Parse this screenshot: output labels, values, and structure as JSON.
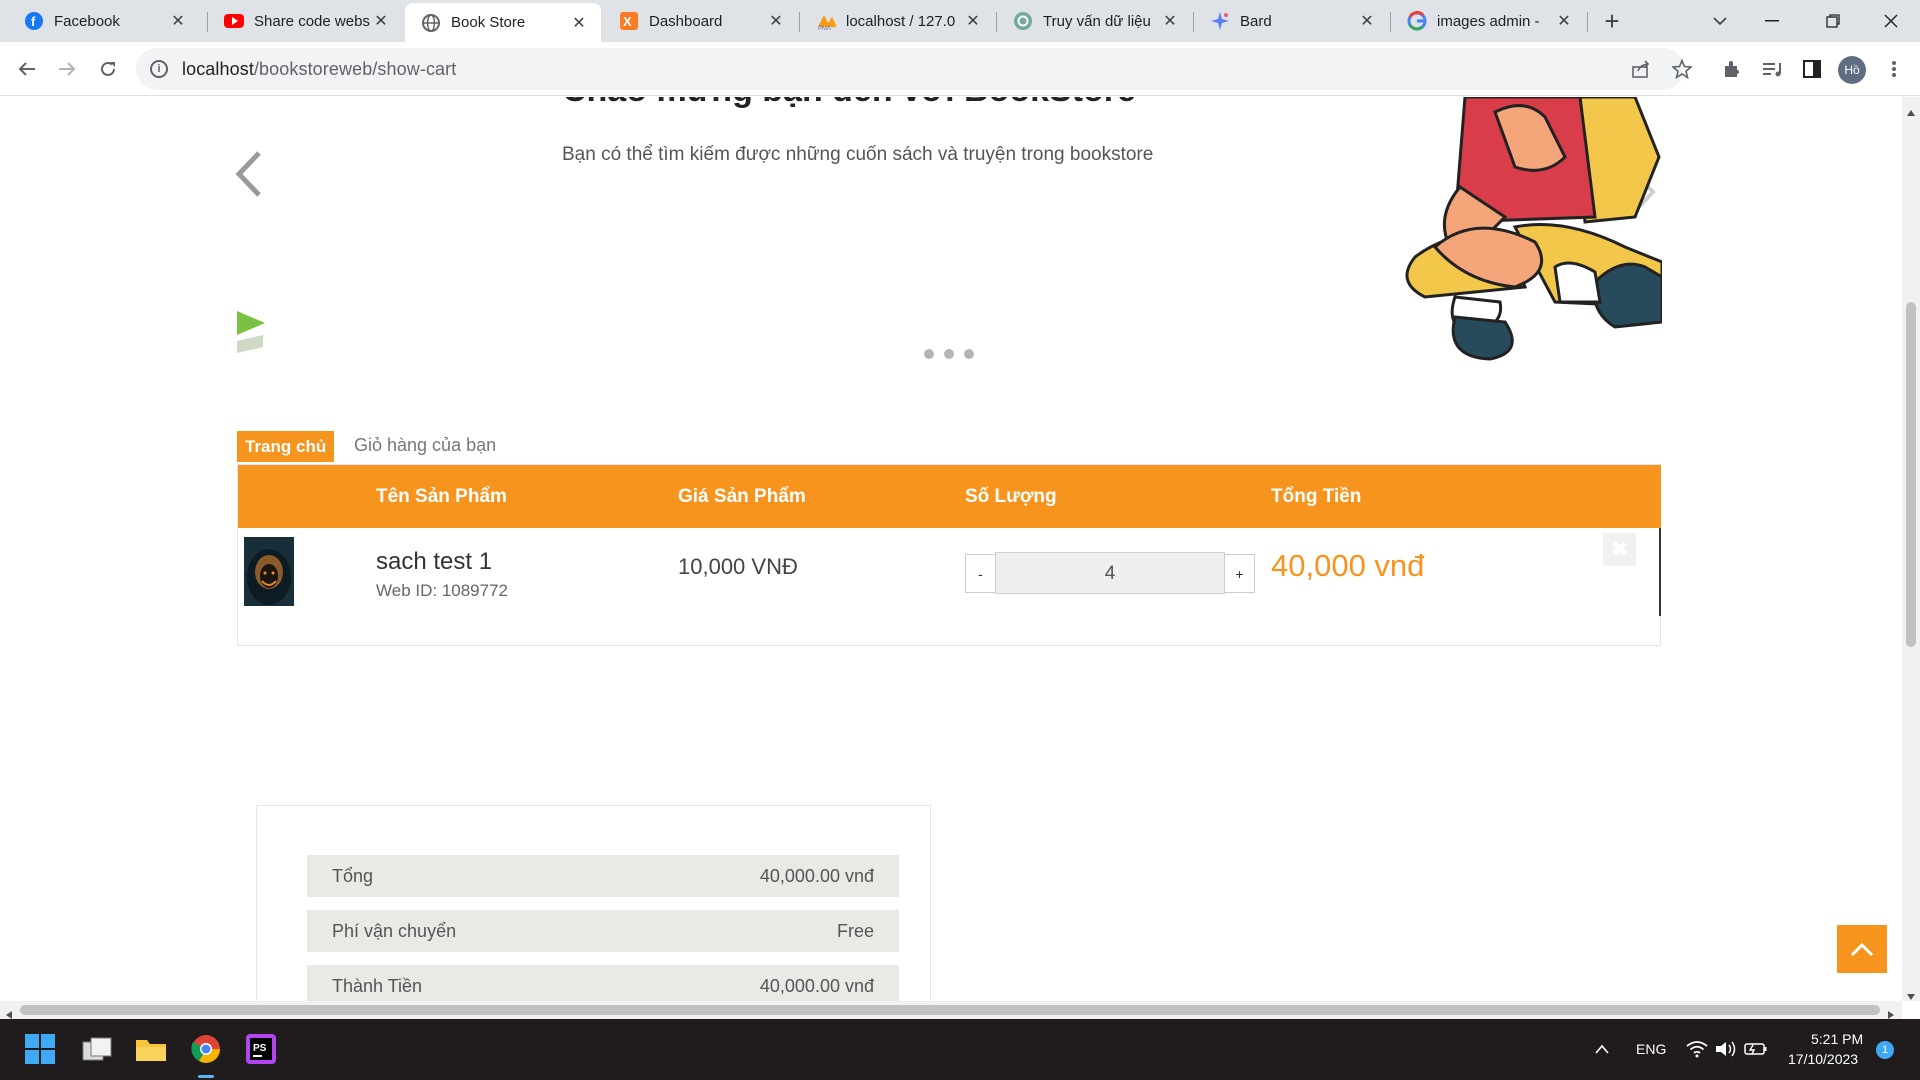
{
  "browser": {
    "tabs": [
      {
        "title": "Facebook",
        "icon": "facebook-icon",
        "active": false
      },
      {
        "title": "Share code webs",
        "icon": "youtube-icon",
        "active": false
      },
      {
        "title": "Book Store",
        "icon": "globe-icon",
        "active": true
      },
      {
        "title": "Dashboard",
        "icon": "xampp-icon",
        "active": false
      },
      {
        "title": "localhost / 127.0",
        "icon": "phpmyadmin-icon",
        "active": false
      },
      {
        "title": "Truy vấn dữ liệu",
        "icon": "chatgpt-icon",
        "active": false
      },
      {
        "title": "Bard",
        "icon": "bard-icon",
        "active": false
      },
      {
        "title": "images admin -",
        "icon": "google-icon",
        "active": false
      }
    ],
    "url_host": "localhost",
    "url_path": "/bookstoreweb/show-cart",
    "profile_initials": "Hồ"
  },
  "hero": {
    "title": "Chào mừng bạn đến với BookStore",
    "subtitle": "Bạn có thể tìm kiếm được những cuốn sách và truyện trong bookstore"
  },
  "breadcrumb": {
    "home": "Trang chủ",
    "current": "Giỏ hàng của bạn"
  },
  "cart": {
    "headers": {
      "name": "Tên Sản Phẩm",
      "price": "Giá Sản Phẩm",
      "quantity": "Số Lượng",
      "total": "Tổng Tiền"
    },
    "items": [
      {
        "name": "sach test 1",
        "web_id": "Web ID: 1089772",
        "price": "10,000 VNĐ",
        "minus": "-",
        "quantity": "4",
        "plus": "+",
        "total": "40,000 vnđ",
        "remove": "✖"
      }
    ]
  },
  "summary": {
    "rows": [
      {
        "label": "Tổng",
        "value": "40,000.00 vnđ"
      },
      {
        "label": "Phí vận chuyển",
        "value": "Free"
      },
      {
        "label": "Thành Tiền",
        "value": "40,000.00 vnđ"
      }
    ]
  },
  "taskbar": {
    "language": "ENG",
    "time": "5:21 PM",
    "date": "17/10/2023",
    "notification_count": "1"
  },
  "colors": {
    "accent": "#f7941d",
    "taskbar": "#201c1e",
    "tabbar": "#dfe3e8"
  }
}
